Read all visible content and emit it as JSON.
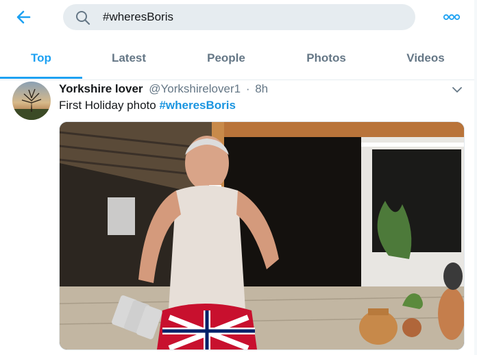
{
  "header": {
    "back_icon": "arrow-left-icon",
    "search": {
      "value": "#wheresBoris",
      "icon": "search-icon"
    },
    "more_icon": "more-dots-icon",
    "accent_color": "#1da1f2"
  },
  "tabs": [
    {
      "label": "Top",
      "active": true
    },
    {
      "label": "Latest",
      "active": false
    },
    {
      "label": "People",
      "active": false
    },
    {
      "label": "Photos",
      "active": false
    },
    {
      "label": "Videos",
      "active": false
    }
  ],
  "tweet": {
    "display_name": "Yorkshire lover",
    "handle": "@Yorkshirelover1",
    "separator": "·",
    "time": "8h",
    "text": "First Holiday photo",
    "hashtag": "#wheresBoris",
    "menu_icon": "chevron-down-icon",
    "media_description": "photo of a man in a mesh vest and union jack shorts holding beer cans outside a restaurant"
  }
}
